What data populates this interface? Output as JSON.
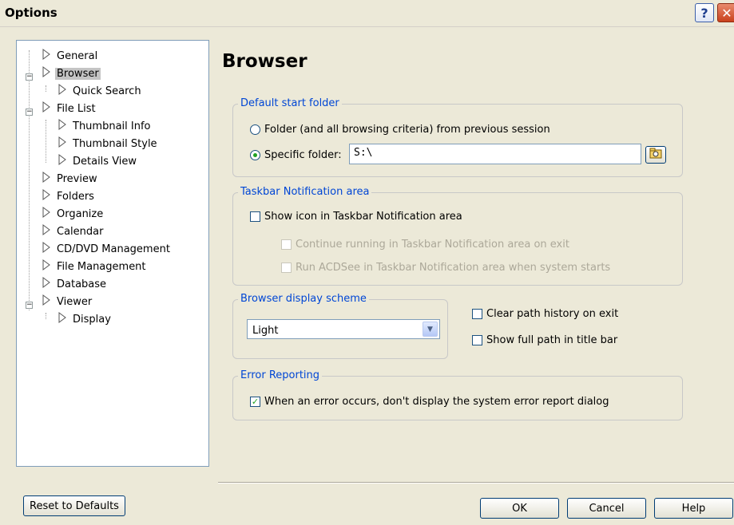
{
  "window": {
    "title": "Options",
    "help_glyph": "?",
    "close_glyph": "✕"
  },
  "tree": {
    "items": [
      {
        "label": "General"
      },
      {
        "label": "Browser"
      },
      {
        "label": "Quick Search"
      },
      {
        "label": "File List"
      },
      {
        "label": "Thumbnail Info"
      },
      {
        "label": "Thumbnail Style"
      },
      {
        "label": "Details View"
      },
      {
        "label": "Preview"
      },
      {
        "label": "Folders"
      },
      {
        "label": "Organize"
      },
      {
        "label": "Calendar"
      },
      {
        "label": "CD/DVD Management"
      },
      {
        "label": "File Management"
      },
      {
        "label": "Database"
      },
      {
        "label": "Viewer"
      },
      {
        "label": "Display"
      }
    ],
    "selected": "Browser"
  },
  "panel": {
    "title": "Browser"
  },
  "default_start_folder": {
    "legend": "Default start folder",
    "option_previous": "Folder (and all browsing criteria) from previous session",
    "option_specific": "Specific folder:",
    "folder_value": "S:\\",
    "selected_option": "Specific folder"
  },
  "taskbar": {
    "legend": "Taskbar Notification area",
    "show_icon": "Show icon in Taskbar Notification area",
    "continue_running": "Continue running in Taskbar Notification area on exit",
    "run_on_start": "Run ACDSee in Taskbar Notification area when system starts"
  },
  "display_scheme": {
    "legend": "Browser display scheme",
    "selected": "Light"
  },
  "options": {
    "clear_path": "Clear path history on exit",
    "show_full_path": "Show full path in title bar"
  },
  "error_reporting": {
    "legend": "Error Reporting",
    "no_dialog": "When an error occurs, don't display the system error report dialog"
  },
  "buttons": {
    "reset": "Reset to Defaults",
    "ok": "OK",
    "cancel": "Cancel",
    "help": "Help"
  }
}
